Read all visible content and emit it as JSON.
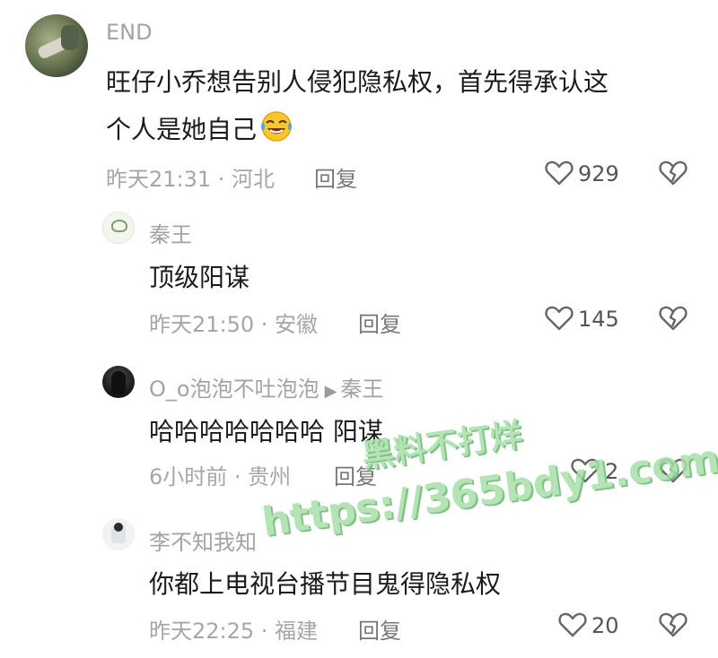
{
  "comments": {
    "main": {
      "username": "END",
      "text_line1": "旺仔小乔想告别人侵犯隐私权，首先得承认这",
      "text_line2": "个人是她自己",
      "emoji": "laughing-crying-emoji",
      "time_location": "昨天21:31 · 河北",
      "reply_label": "回复",
      "likes": "929"
    },
    "replies": [
      {
        "username": "秦王",
        "text": "顶级阳谋",
        "time_location": "昨天21:50 · 安徽",
        "reply_label": "回复",
        "likes": "145"
      },
      {
        "username": "O_o泡泡不吐泡泡",
        "reply_to": "秦王",
        "text": "哈哈哈哈哈哈哈 阳谋",
        "time_location": "6小时前 · 贵州",
        "reply_label": "回复",
        "likes": "2"
      },
      {
        "username": "李不知我知",
        "text": "你都上电视台播节目鬼得隐私权",
        "time_location": "昨天22:25 · 福建",
        "reply_label": "回复",
        "likes": "20"
      }
    ]
  },
  "watermark": {
    "line1": "黑料不打烊",
    "line2": "https://365bdy1.com"
  },
  "icons": {
    "like": "heart-outline-icon",
    "dislike": "broken-heart-icon",
    "reply_arrow": "triangle-right-icon"
  },
  "colors": {
    "text": "#1b1b1b",
    "meta": "#a6a6a6",
    "watermark": "#a7e0a9"
  }
}
